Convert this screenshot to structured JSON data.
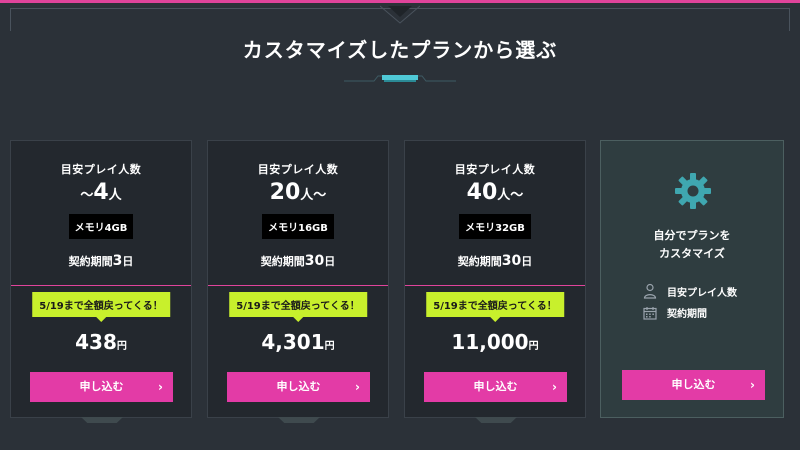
{
  "heading": "カスタマイズしたプランから選ぶ",
  "colors": {
    "accent": "#e33ba6",
    "badge": "#c8f02c",
    "teal": "#4fc9d6"
  },
  "plans": [
    {
      "label": "目安プレイ人数",
      "count_prefix": "〜",
      "count": "4",
      "count_suffix": "人",
      "memory": "メモリ4GB",
      "term_label": "契約期間",
      "term_value": "3",
      "term_unit": "日",
      "badge": "5/19まで全額戻ってくる！",
      "price": "438",
      "yen": "円",
      "button": "申し込む"
    },
    {
      "label": "目安プレイ人数",
      "count_prefix": "",
      "count": "20",
      "count_suffix": "人〜",
      "memory": "メモリ16GB",
      "term_label": "契約期間",
      "term_value": "30",
      "term_unit": "日",
      "badge": "5/19まで全額戻ってくる！",
      "price": "4,301",
      "yen": "円",
      "button": "申し込む"
    },
    {
      "label": "目安プレイ人数",
      "count_prefix": "",
      "count": "40",
      "count_suffix": "人〜",
      "memory": "メモリ32GB",
      "term_label": "契約期間",
      "term_value": "30",
      "term_unit": "日",
      "badge": "5/19まで全額戻ってくる！",
      "price": "11,000",
      "yen": "円",
      "button": "申し込む"
    }
  ],
  "custom": {
    "title_line1": "自分でプランを",
    "title_line2": "カスタマイズ",
    "row1": "目安プレイ人数",
    "row2": "契約期間",
    "button": "申し込む",
    "icon": "gear-icon"
  }
}
